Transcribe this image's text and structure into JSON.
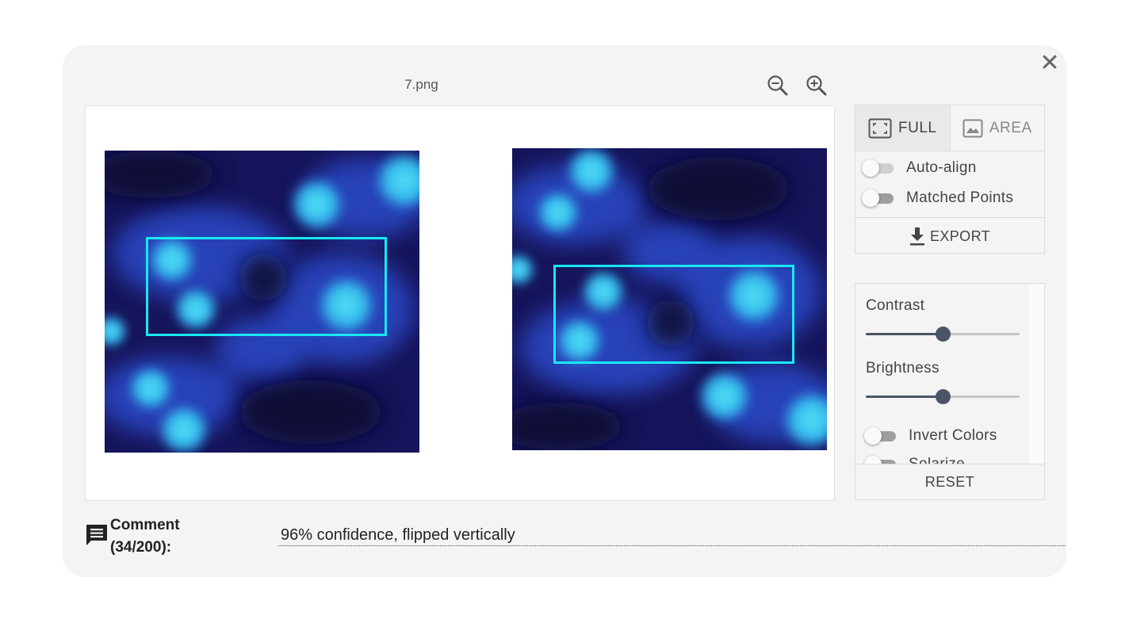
{
  "dialog": {
    "filename": "7.png",
    "close_icon": "close-icon",
    "zoom_out_icon": "zoom-out-icon",
    "zoom_in_icon": "zoom-in-icon"
  },
  "view_modes": {
    "full_label": "FULL",
    "area_label": "AREA",
    "selected": "FULL"
  },
  "toggles": {
    "auto_align": {
      "label": "Auto-align",
      "on": false
    },
    "matched_points": {
      "label": "Matched Points",
      "on": false
    }
  },
  "export_label": "EXPORT",
  "adjustments": {
    "contrast": {
      "label": "Contrast",
      "value": 0.5
    },
    "brightness": {
      "label": "Brightness",
      "value": 0.5
    },
    "invert_colors": {
      "label": "Invert Colors",
      "on": false
    },
    "solarize": {
      "label": "Solarize",
      "on": false
    }
  },
  "reset_label": "RESET",
  "comment": {
    "label": "Comment (34/200):",
    "value": "96% confidence, flipped vertically"
  },
  "colors": {
    "selection_box": "#19e8f2",
    "slider_active": "#4a5465",
    "image_dark": "#14124a",
    "image_cell": "#3fd3f0"
  }
}
